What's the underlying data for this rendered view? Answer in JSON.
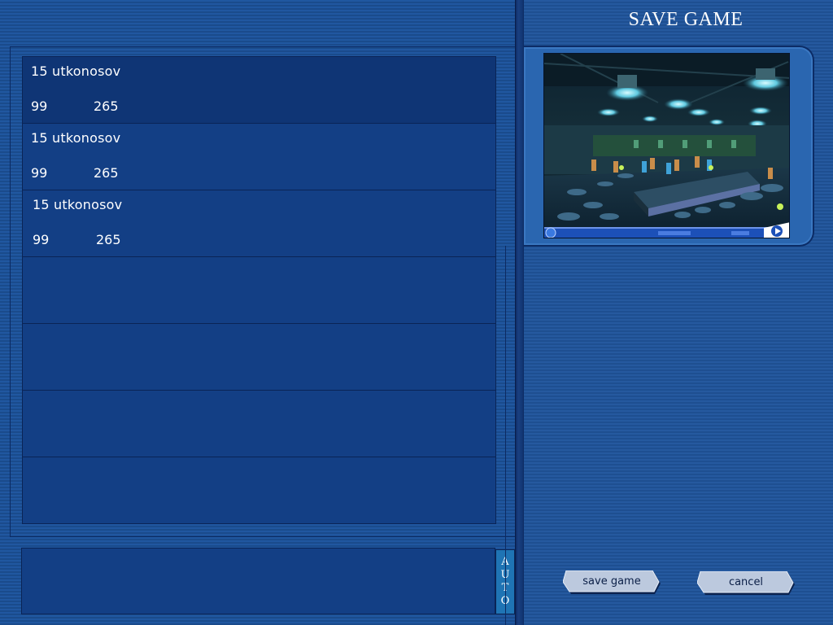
{
  "header": {
    "title": "SAVE GAME"
  },
  "slots": [
    {
      "name": "15 utkonosov",
      "money": "99",
      "day": "265"
    },
    {
      "name": "15 utkonosov",
      "money": "99",
      "day": "265"
    },
    {
      "name": " 15 utkonosov",
      "money": " 99",
      "day": "265"
    },
    {
      "name": "",
      "money": "",
      "day": ""
    },
    {
      "name": "",
      "money": "",
      "day": ""
    },
    {
      "name": "",
      "money": "",
      "day": ""
    },
    {
      "name": "",
      "money": "",
      "day": ""
    }
  ],
  "input": {
    "value": ""
  },
  "auto_button": {
    "letters": [
      "A",
      "U",
      "T",
      "O"
    ]
  },
  "buttons": {
    "save_label": "save game",
    "cancel_label": "cancel"
  },
  "colors": {
    "background": "#1c4f93",
    "slot_bg": "#133f85",
    "accent": "#1f74b4",
    "button_face": "#b8c7de"
  },
  "icons": {
    "preview": "game-screenshot-thumbnail"
  }
}
